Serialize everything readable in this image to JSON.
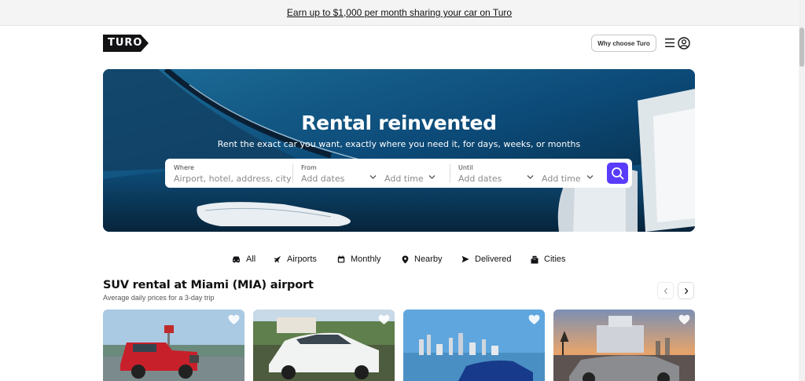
{
  "promo": {
    "text": "Earn up to $1,000 per month sharing your car on Turo"
  },
  "header": {
    "logo_text": "TURO",
    "why_label": "Why choose Turo"
  },
  "hero": {
    "title": "Rental reinvented",
    "subtitle": "Rent the exact car you want, exactly where you need it, for days, weeks, or months"
  },
  "search": {
    "where_label": "Where",
    "where_placeholder": "Airport, hotel, address, city",
    "from_label": "From",
    "from_date": "Add dates",
    "from_time": "Add time",
    "until_label": "Until",
    "until_date": "Add dates",
    "until_time": "Add time"
  },
  "categories": [
    {
      "label": "All",
      "icon": "car-icon"
    },
    {
      "label": "Airports",
      "icon": "airplane-icon"
    },
    {
      "label": "Monthly",
      "icon": "calendar-icon"
    },
    {
      "label": "Nearby",
      "icon": "location-pin-icon"
    },
    {
      "label": "Delivered",
      "icon": "send-arrow-icon"
    },
    {
      "label": "Cities",
      "icon": "buildings-icon"
    }
  ],
  "section": {
    "title": "SUV rental at Miami (MIA) airport",
    "subtitle": "Average daily prices for a 3-day trip"
  },
  "colors": {
    "brand_black": "#121214",
    "accent_purple": "#593cfb",
    "hero_blue": "#0b3f66"
  }
}
